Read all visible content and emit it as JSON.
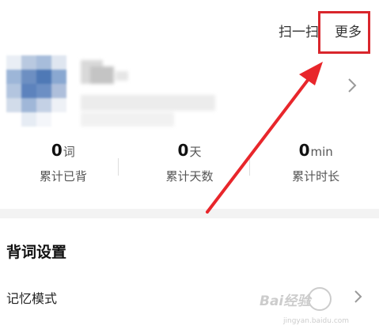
{
  "header": {
    "scan_label": "扫一扫",
    "more_label": "更多",
    "highlight_color": "#d9262c"
  },
  "profile": {
    "avatar_icon": "pixelated-avatar-icon",
    "name_obscured": true
  },
  "stats": [
    {
      "value": "0",
      "unit": "词",
      "label": "累计已背"
    },
    {
      "value": "0",
      "unit": "天",
      "label": "累计天数"
    },
    {
      "value": "0",
      "unit": "min",
      "label": "累计时长"
    }
  ],
  "settings": {
    "section_title": "背词设置",
    "items": [
      {
        "label": "记忆模式"
      }
    ]
  },
  "watermark": {
    "brand": "Bai经验",
    "url": "jingyan.baidu.com"
  }
}
